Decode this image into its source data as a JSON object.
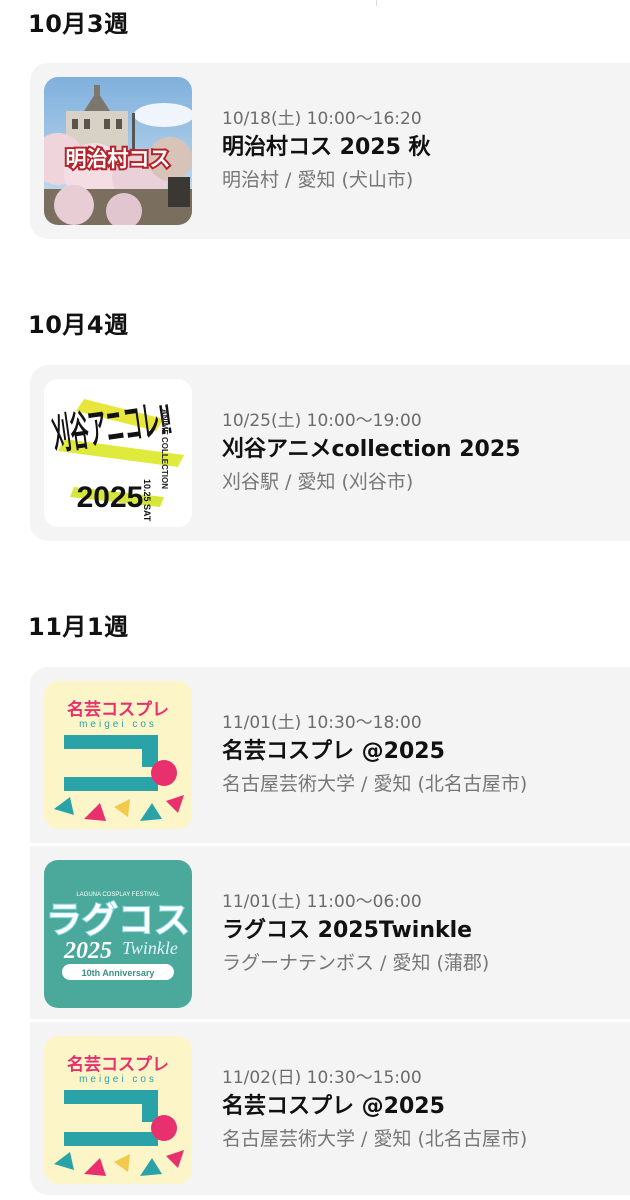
{
  "sections": [
    {
      "heading": "10月3週",
      "events": [
        {
          "datetime": "10/18(土) 10:00〜16:20",
          "title": "明治村コス 2025 秋",
          "venue": "明治村 / 愛知 (犬山市)",
          "thumb_label": "明治村コス"
        }
      ]
    },
    {
      "heading": "10月4週",
      "events": [
        {
          "datetime": "10/25(土) 10:00〜19:00",
          "title": "刈谷アニメcollection 2025",
          "venue": "刈谷駅 / 愛知 (刈谷市)",
          "thumb_label": "刈谷アニコレ!!",
          "thumb_sub": "ANIME COLLECTION",
          "thumb_year": "2025",
          "thumb_date": "10.25 SAT"
        }
      ]
    },
    {
      "heading": "11月1週",
      "events": [
        {
          "datetime": "11/01(土) 10:30〜18:00",
          "title": "名芸コスプレ @2025",
          "venue": "名古屋芸術大学 / 愛知 (北名古屋市)",
          "thumb_label": "名芸コスプレ",
          "thumb_sub": "meigei cos"
        },
        {
          "datetime": "11/01(土) 11:00〜06:00",
          "title": "ラグコス 2025Twinkle",
          "venue": "ラグーナテンボス / 愛知 (蒲郡)",
          "thumb_label": "ラグコス",
          "thumb_sub": "LAGUNA COSPLAY FESTIVAL",
          "thumb_year": "2025",
          "thumb_script": "Twinkle",
          "thumb_anniv": "10th Anniversary"
        },
        {
          "datetime": "11/02(日) 10:30〜15:00",
          "title": "名芸コスプレ @2025",
          "venue": "名古屋芸術大学 / 愛知 (北名古屋市)",
          "thumb_label": "名芸コスプレ",
          "thumb_sub": "meigei cos"
        }
      ]
    }
  ],
  "colors": {
    "card_bg": "#f4f4f4",
    "meigei_bg": "#fbf5c8",
    "meigei_teal": "#2aa3a8",
    "meigei_pink": "#e8306e",
    "laguna_bg": "#4aa99a"
  }
}
